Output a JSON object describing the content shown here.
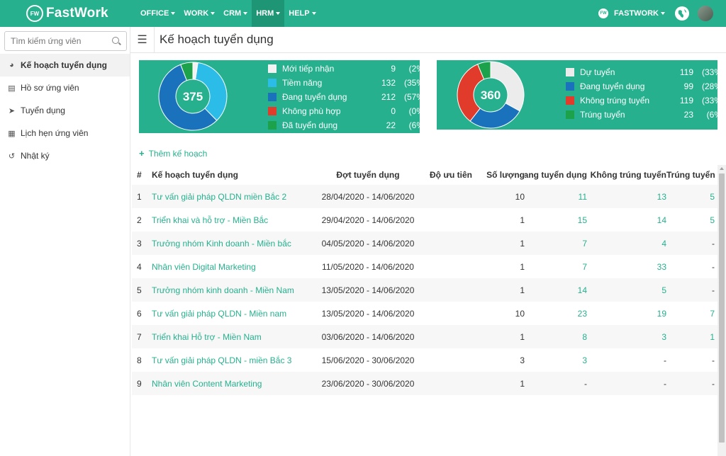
{
  "app": {
    "logo_mark": "FW",
    "name": "FastWork"
  },
  "nav": [
    {
      "label": "OFFICE",
      "active": false
    },
    {
      "label": "WORK",
      "active": false
    },
    {
      "label": "CRM",
      "active": false
    },
    {
      "label": "HRM",
      "active": true
    },
    {
      "label": "HELP",
      "active": false
    }
  ],
  "topright": {
    "org_badge": "FW",
    "org_name": "FASTWORK",
    "globe_icon": "globe-icon",
    "avatar": "user-avatar"
  },
  "sidebar": {
    "search_placeholder": "Tìm kiếm ứng viên",
    "items": [
      {
        "label": "Kế hoạch tuyển dụng",
        "icon": "dashboard-icon",
        "active": true
      },
      {
        "label": "Hồ sơ ứng viên",
        "icon": "file-icon",
        "active": false
      },
      {
        "label": "Tuyển dụng",
        "icon": "paper-plane-icon",
        "active": false
      },
      {
        "label": "Lịch hẹn ứng viên",
        "icon": "calendar-icon",
        "active": false
      },
      {
        "label": "Nhật ký",
        "icon": "history-icon",
        "active": false
      }
    ]
  },
  "header": {
    "title": "Kế hoạch tuyển dụng",
    "menu_icon": "hamburger-icon"
  },
  "stats_left": {
    "total": "375",
    "items": [
      {
        "label": "Mới tiếp nhận",
        "count": "9",
        "pct": "(2%)",
        "value": 9,
        "color": "#f2f2f2"
      },
      {
        "label": "Tiềm năng",
        "count": "132",
        "pct": "(35%)",
        "value": 132,
        "color": "#2bbde8"
      },
      {
        "label": "Đang tuyển dụng",
        "count": "212",
        "pct": "(57%)",
        "value": 212,
        "color": "#1a72bd"
      },
      {
        "label": "Không phù hợp",
        "count": "0",
        "pct": "(0%)",
        "value": 0,
        "color": "#e13b2b"
      },
      {
        "label": "Đã tuyển dụng",
        "count": "22",
        "pct": "(6%)",
        "value": 22,
        "color": "#1ca24a"
      }
    ]
  },
  "stats_right": {
    "total": "360",
    "items": [
      {
        "label": "Dự tuyển",
        "count": "119",
        "pct": "(33%)",
        "value": 119,
        "color": "#ececec"
      },
      {
        "label": "Đang tuyển dụng",
        "count": "99",
        "pct": "(28%)",
        "value": 99,
        "color": "#1a72bd"
      },
      {
        "label": "Không trúng tuyển",
        "count": "119",
        "pct": "(33%)",
        "value": 119,
        "color": "#e13b2b"
      },
      {
        "label": "Trúng tuyển",
        "count": "23",
        "pct": "(6%)",
        "value": 23,
        "color": "#1ca24a"
      }
    ]
  },
  "add_plan_label": "Thêm kế hoạch",
  "table": {
    "headers": {
      "idx": "#",
      "name": "Kế hoạch tuyển dụng",
      "period": "Đợt tuyển dụng",
      "priority": "Độ ưu tiên",
      "qty": "Số lượng",
      "ongoing": "Đang tuyển dụng",
      "not_passed": "Không trúng tuyển",
      "passed": "Trúng tuyển"
    },
    "rows": [
      {
        "idx": "1",
        "name": "Tư vấn giải pháp QLDN miền Bắc 2",
        "period": "28/04/2020 - 14/06/2020",
        "priority": "",
        "qty": "10",
        "ongoing": "11",
        "not_passed": "13",
        "passed": "5"
      },
      {
        "idx": "2",
        "name": "Triển khai và hỗ trợ - Miền Bắc",
        "period": "29/04/2020 - 14/06/2020",
        "priority": "",
        "qty": "1",
        "ongoing": "15",
        "not_passed": "14",
        "passed": "5"
      },
      {
        "idx": "3",
        "name": "Trưởng nhóm Kinh doanh - Miền bắc",
        "period": "04/05/2020 - 14/06/2020",
        "priority": "",
        "qty": "1",
        "ongoing": "7",
        "not_passed": "4",
        "passed": "-"
      },
      {
        "idx": "4",
        "name": "Nhân viên Digital Marketing",
        "period": "11/05/2020 - 14/06/2020",
        "priority": "",
        "qty": "1",
        "ongoing": "7",
        "not_passed": "33",
        "passed": "-"
      },
      {
        "idx": "5",
        "name": "Trưởng nhóm kinh doanh - Miền Nam",
        "period": "13/05/2020 - 14/06/2020",
        "priority": "",
        "qty": "1",
        "ongoing": "14",
        "not_passed": "5",
        "passed": "-"
      },
      {
        "idx": "6",
        "name": "Tư vấn giải pháp QLDN - Miền nam",
        "period": "13/05/2020 - 14/06/2020",
        "priority": "",
        "qty": "10",
        "ongoing": "23",
        "not_passed": "19",
        "passed": "7"
      },
      {
        "idx": "7",
        "name": "Triển khai Hỗ trợ - Miền Nam",
        "period": "03/06/2020 - 14/06/2020",
        "priority": "",
        "qty": "1",
        "ongoing": "8",
        "not_passed": "3",
        "passed": "1"
      },
      {
        "idx": "8",
        "name": "Tư vấn giải pháp QLDN - miền Bắc 3",
        "period": "15/06/2020 - 30/06/2020",
        "priority": "",
        "qty": "3",
        "ongoing": "3",
        "not_passed": "-",
        "passed": "-"
      },
      {
        "idx": "9",
        "name": "Nhân viên Content Marketing",
        "period": "23/06/2020 - 30/06/2020",
        "priority": "",
        "qty": "1",
        "ongoing": "-",
        "not_passed": "-",
        "passed": "-"
      }
    ]
  },
  "colors": {
    "brand": "#26b08e",
    "brand_dark": "#1e9676",
    "link": "#26b08e"
  }
}
